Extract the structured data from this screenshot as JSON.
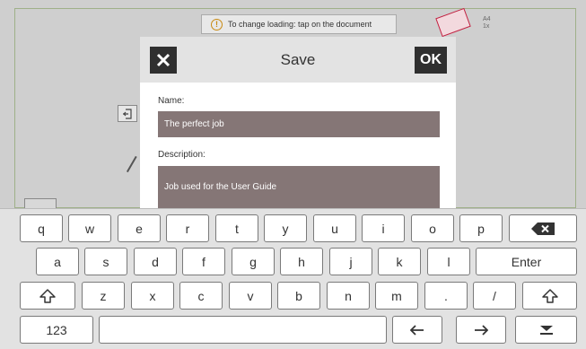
{
  "background": {
    "hint_text": "To change loading: tap on the document",
    "hint_icon": "info-icon",
    "paper_size": "A4",
    "paper_count": "1x"
  },
  "dialog": {
    "title": "Save",
    "close_icon": "close-icon",
    "ok_label": "OK",
    "name_label": "Name:",
    "name_value": "The perfect job",
    "description_label": "Description:",
    "description_value": "Job used for the User Guide"
  },
  "keyboard": {
    "row1": [
      "q",
      "w",
      "e",
      "r",
      "t",
      "y",
      "u",
      "i",
      "o",
      "p"
    ],
    "row2": [
      "a",
      "s",
      "d",
      "f",
      "g",
      "h",
      "j",
      "k",
      "l"
    ],
    "row3": [
      "z",
      "x",
      "c",
      "v",
      "b",
      "n",
      "m",
      ".",
      "/"
    ],
    "enter_label": "Enter",
    "numbers_label": "123",
    "backspace_icon": "backspace-icon",
    "shift_icon": "shift-icon",
    "left_icon": "arrow-left-icon",
    "right_icon": "arrow-right-icon",
    "hide_icon": "hide-keyboard-icon"
  },
  "colors": {
    "field_bg": "#857676",
    "button_dark": "#2f2f2f",
    "paper_accent": "#c02040"
  }
}
